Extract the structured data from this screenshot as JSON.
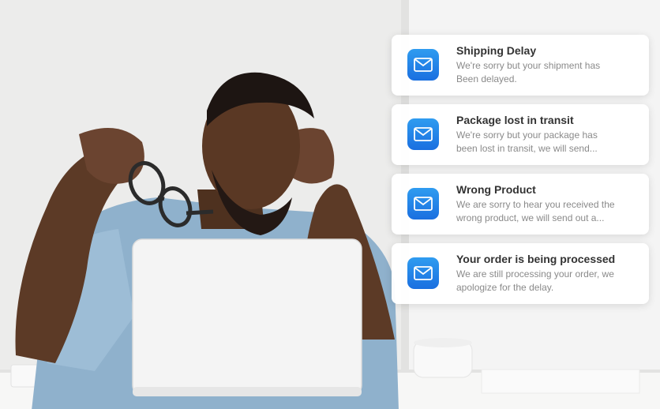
{
  "notifications": [
    {
      "icon": "mail-icon",
      "title": "Shipping Delay",
      "body_line1": "We're sorry but your shipment has",
      "body_line2": "Been delayed."
    },
    {
      "icon": "mail-icon",
      "title": "Package lost in transit",
      "body_line1": "We're sorry but your package has",
      "body_line2": "been lost in transit, we will send..."
    },
    {
      "icon": "mail-icon",
      "title": "Wrong Product",
      "body_line1": "We are sorry to hear you received the",
      "body_line2": "wrong product, we will send out a..."
    },
    {
      "icon": "mail-icon",
      "title": "Your order is being processed",
      "body_line1": "We are still processing your order, we",
      "body_line2": "apologize for the delay."
    }
  ],
  "colors": {
    "icon_gradient_top": "#2f9cf0",
    "icon_gradient_bottom": "#1a6fe0",
    "title": "#333333",
    "body": "#8a8a8a"
  }
}
